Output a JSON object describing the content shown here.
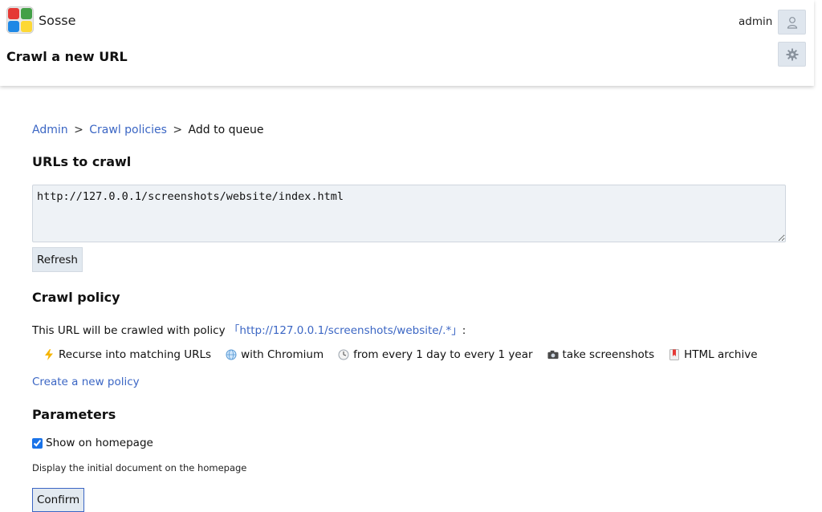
{
  "app": {
    "name": "Sosse",
    "page_title": "Crawl a new URL"
  },
  "user": {
    "name": "admin"
  },
  "icons": {
    "user": "user-icon",
    "settings": "gear-icon",
    "recurse": "lightning-icon",
    "browser": "globe-icon",
    "frequency": "clock-icon",
    "screenshot": "camera-icon",
    "archive": "bookmark-icon"
  },
  "breadcrumb": {
    "items": [
      "Admin",
      "Crawl policies",
      "Add to queue"
    ],
    "separator": ">"
  },
  "urls_section": {
    "heading": "URLs to crawl",
    "value": "http://127.0.0.1/screenshots/website/index.html",
    "refresh_label": "Refresh"
  },
  "policy_section": {
    "heading": "Crawl policy",
    "prefix": "This URL will be crawled with policy",
    "policy_link": "「http://127.0.0.1/screenshots/website/.*」",
    "suffix": ":",
    "features": [
      "Recurse into matching URLs",
      "with Chromium",
      "from every 1 day to every 1 year",
      "take screenshots",
      "HTML archive"
    ],
    "create_link": "Create a new policy"
  },
  "params_section": {
    "heading": "Parameters",
    "show_on_homepage_label": "Show on homepage",
    "show_on_homepage_checked": true,
    "help_text": "Display the initial document on the homepage",
    "confirm_label": "Confirm"
  },
  "colors": {
    "link": "#3b66c4",
    "button_bg": "#e2e9f0",
    "input_bg": "#eef2f6",
    "confirm_border": "#3b66c4"
  }
}
